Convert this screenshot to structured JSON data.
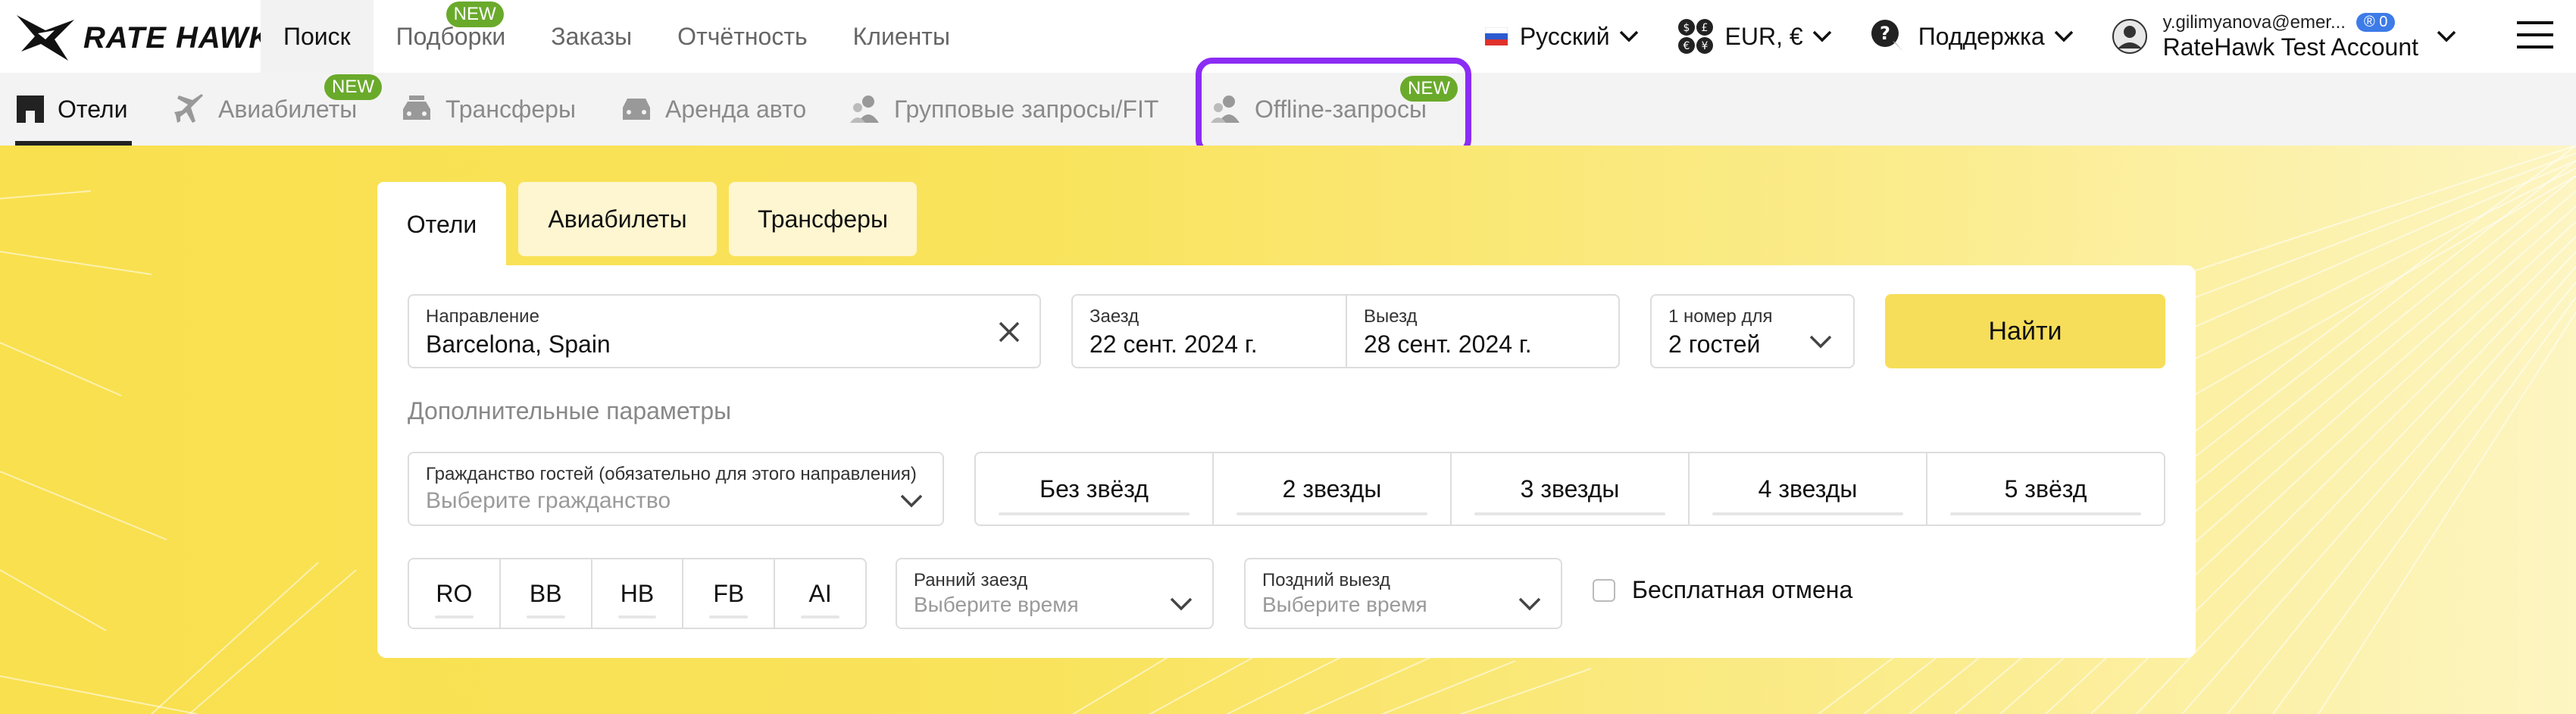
{
  "header": {
    "logo_text": "RATE HAWK",
    "nav": [
      {
        "label": "Поиск"
      },
      {
        "label": "Подборки",
        "badge": "NEW"
      },
      {
        "label": "Заказы"
      },
      {
        "label": "Отчётность"
      },
      {
        "label": "Клиенты"
      }
    ],
    "language": "Русский",
    "currency": "EUR, €",
    "support": "Поддержка",
    "account_email": "y.gilimyanova@emer...",
    "account_count": "0",
    "account_name": "RateHawk Test Account"
  },
  "subnav": [
    {
      "label": "Отели"
    },
    {
      "label": "Авиабилеты",
      "badge": "NEW"
    },
    {
      "label": "Трансферы"
    },
    {
      "label": "Аренда авто"
    },
    {
      "label": "Групповые запросы/FIT"
    },
    {
      "label": "Offline-запросы",
      "badge": "NEW"
    }
  ],
  "search": {
    "tabs": [
      {
        "label": "Отели"
      },
      {
        "label": "Авиабилеты"
      },
      {
        "label": "Трансферы"
      }
    ],
    "destination": {
      "label": "Направление",
      "value": "Barcelona, Spain"
    },
    "checkin": {
      "label": "Заезд",
      "value": "22 сент. 2024 г."
    },
    "checkout": {
      "label": "Выезд",
      "value": "28 сент. 2024 г."
    },
    "guests": {
      "label": "1 номер для",
      "value": "2 гостей"
    },
    "find_button": "Найти",
    "extra_params": "Дополнительные параметры",
    "citizenship": {
      "label": "Гражданство гостей (обязательно для этого направления)",
      "placeholder": "Выберите гражданство"
    },
    "stars": [
      "Без звёзд",
      "2 звезды",
      "3 звезды",
      "4 звезды",
      "5 звёзд"
    ],
    "meals": [
      "RO",
      "BB",
      "HB",
      "FB",
      "AI"
    ],
    "early_checkin": {
      "label": "Ранний заезд",
      "placeholder": "Выберите время"
    },
    "late_checkout": {
      "label": "Поздний выезд",
      "placeholder": "Выберите время"
    },
    "free_cancel": "Бесплатная отмена"
  },
  "colors": {
    "accent_yellow": "#f7de5a",
    "badge_green": "#6aaa2b",
    "highlight_purple": "#8b2cf5"
  }
}
